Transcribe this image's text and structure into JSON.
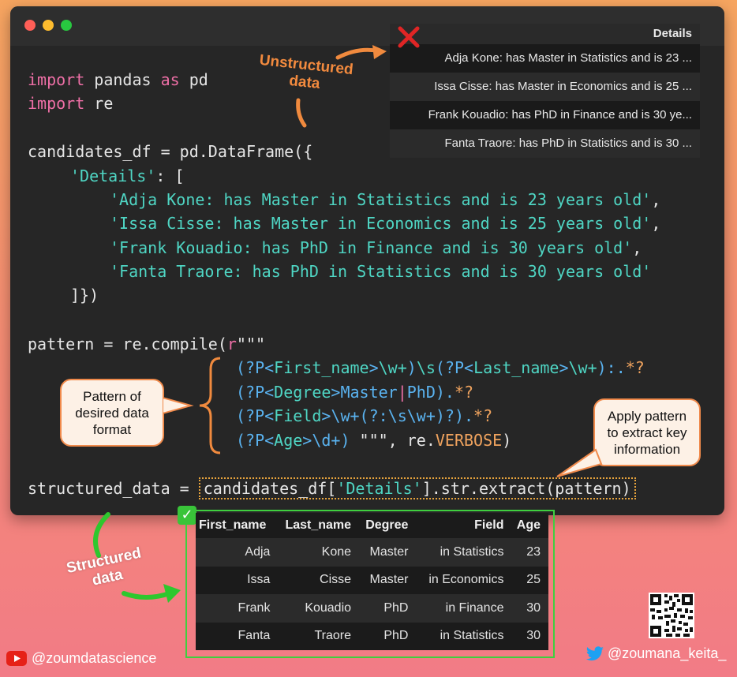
{
  "window": {
    "dots": [
      {
        "name": "close",
        "color": "#ff5f57"
      },
      {
        "name": "minimize",
        "color": "#febc2e"
      },
      {
        "name": "maximize",
        "color": "#28c840"
      }
    ]
  },
  "code": {
    "l1_kw1": "import",
    "l1_mod": " pandas ",
    "l1_kw2": "as",
    "l1_alias": " pd",
    "l2_kw": "import",
    "l2_mod": " re",
    "l3": "candidates_df = pd.DataFrame({",
    "l4_key": "'Details'",
    "l4_rest": ": [",
    "l5_str": "'Adja Kone: has Master in Statistics and is 23 years old'",
    "l5_rest": ",",
    "l6_str": "'Issa Cisse: has Master in Economics and is 25 years old'",
    "l6_rest": ",",
    "l7_str": "'Frank Kouadio: has PhD in Finance and is 30 years old'",
    "l7_rest": ",",
    "l8_str": "'Fanta Traore: has PhD in Statistics and is 30 years old'",
    "l9": "]})",
    "l10_a": "pattern = re.compile(",
    "l10_r": "r",
    "l10_q": "\"\"\"",
    "l11_a": "(?P<",
    "l11_n1": "First_name",
    "l11_b": ">",
    "l11_c": "\\w+",
    "l11_d": ")",
    "l11_e": "\\s",
    "l11_f": "(?P<",
    "l11_n2": "Last_name",
    "l11_g": ">",
    "l11_h": "\\w+",
    "l11_i": ")",
    "l11_j": ":.",
    "l11_k": "*?",
    "l12_a": "(?P<",
    "l12_n": "Degree",
    "l12_b": ">Master",
    "l12_c": "|",
    "l12_d": "PhD).",
    "l12_e": "*?",
    "l13_a": "(?P<",
    "l13_n": "Field",
    "l13_b": ">\\w+(?:\\s\\w+)?).",
    "l13_c": "*?",
    "l14_a": "(?P<",
    "l14_n": "Age",
    "l14_b": ">\\d+) ",
    "l14_q": "\"\"\"",
    "l14_c": ", re.",
    "l14_d": "VERBOSE",
    "l14_e": ")",
    "l15_a": "structured_data = ",
    "l15_b": "candidates_df[",
    "l15_key": "'Details'",
    "l15_c": "].str.extract(pattern)"
  },
  "details_table": {
    "header": "Details",
    "rows": [
      "Adja Kone: has Master in Statistics and is 23 ...",
      "Issa Cisse: has Master in Economics and is 25 ...",
      "Frank Kouadio: has PhD in Finance and is 30 ye...",
      "Fanta Traore: has PhD in Statistics and is 30 ..."
    ]
  },
  "annotations": {
    "unstructured_line1": "Unstructured",
    "unstructured_line2": "data",
    "pattern_bubble_l1": "Pattern of",
    "pattern_bubble_l2": "desired data",
    "pattern_bubble_l3": "format",
    "apply_bubble_l1": "Apply pattern",
    "apply_bubble_l2": "to extract key",
    "apply_bubble_l3": "information",
    "structured_line1": "Structured",
    "structured_line2": "data"
  },
  "result_table": {
    "headers": [
      "First_name",
      "Last_name",
      "Degree",
      "Field",
      "Age"
    ],
    "rows": [
      [
        "Adja",
        "Kone",
        "Master",
        "in Statistics",
        "23"
      ],
      [
        "Issa",
        "Cisse",
        "Master",
        "in Economics",
        "25"
      ],
      [
        "Frank",
        "Kouadio",
        "PhD",
        "in Finance",
        "30"
      ],
      [
        "Fanta",
        "Traore",
        "PhD",
        "in Statistics",
        "30"
      ]
    ]
  },
  "social": {
    "youtube": "@zoumdatascience",
    "twitter": "@zoumana_keita_"
  }
}
